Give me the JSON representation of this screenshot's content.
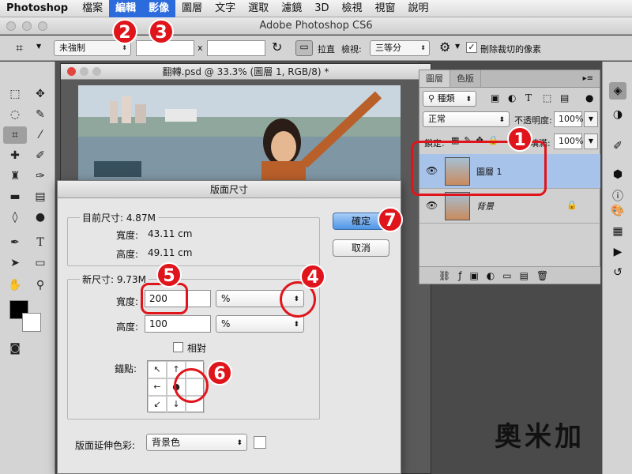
{
  "menu": {
    "app": "Photoshop",
    "items": [
      "檔案",
      "編輯",
      "影像",
      "圖層",
      "文字",
      "選取",
      "濾鏡",
      "3D",
      "檢視",
      "視窗",
      "說明"
    ],
    "highlighted": [
      "編輯",
      "影像"
    ]
  },
  "window": {
    "title": "Adobe Photoshop CS6"
  },
  "options_bar": {
    "ratio_value": "未強制",
    "x_symbol": "x",
    "straighten_label": "拉直",
    "view_label": "檢視:",
    "view_value": "三等分",
    "delete_cropped_label": "刪除裁切的像素",
    "delete_cropped_checked": true
  },
  "document": {
    "title": "翻轉.psd @ 33.3% (圖層 1, RGB/8) *"
  },
  "layers_panel": {
    "tabs": [
      "圖層",
      "色版"
    ],
    "filter_value": "種類",
    "blend_mode": "正常",
    "opacity_label": "不透明度:",
    "opacity_value": "100%",
    "lock_label": "鎖定:",
    "fill_label": "填滿:",
    "fill_value": "100%",
    "layers": [
      {
        "name": "圖層 1",
        "selected": true,
        "locked": false
      },
      {
        "name": "背景",
        "selected": false,
        "locked": true
      }
    ]
  },
  "dialog": {
    "title": "版面尺寸",
    "current_size_label": "目前尺寸: 4.87M",
    "current_width_label": "寬度:",
    "current_width_value": "43.11 cm",
    "current_height_label": "高度:",
    "current_height_value": "49.11 cm",
    "new_size_label": "新尺寸: 9.73M",
    "width_label": "寬度:",
    "width_value": "200",
    "width_unit": "%",
    "height_label": "高度:",
    "height_value": "100",
    "height_unit": "%",
    "relative_label": "相對",
    "relative_checked": false,
    "anchor_label": "錨點:",
    "extension_color_label": "版面延伸色彩:",
    "extension_color_value": "背景色",
    "ok_label": "確定",
    "cancel_label": "取消"
  },
  "callouts": [
    "1",
    "2",
    "3",
    "4",
    "5",
    "6",
    "7"
  ],
  "logo_text": "奧米加",
  "colors": {
    "callout_red": "#e0151b",
    "menu_highlight": "#2c6bdc",
    "selected_layer": "#a8c3ea"
  }
}
